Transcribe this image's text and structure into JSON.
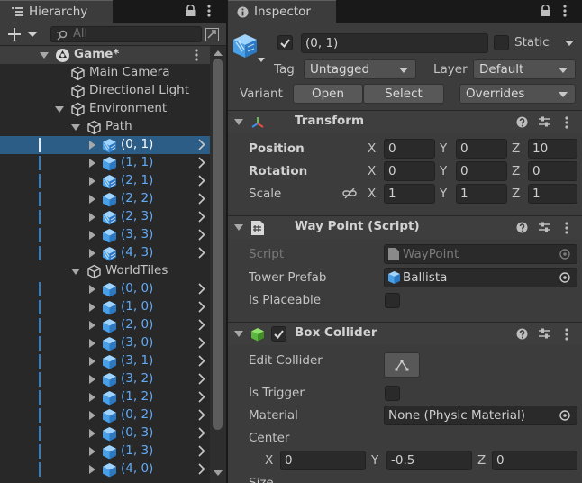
{
  "hierarchy": {
    "tab_label": "Hierarchy",
    "search_placeholder": "All",
    "rows": [
      {
        "label": "Game*",
        "depth": 0,
        "expanded": true,
        "kind": "scene"
      },
      {
        "label": "Main Camera",
        "depth": 1,
        "kind": "object"
      },
      {
        "label": "Directional Light",
        "depth": 1,
        "kind": "object"
      },
      {
        "label": "Environment",
        "depth": 1,
        "expanded": true,
        "kind": "object"
      },
      {
        "label": "Path",
        "depth": 2,
        "expanded": true,
        "kind": "object"
      },
      {
        "label": "(0, 1)",
        "depth": 3,
        "kind": "prefab-striped",
        "selected": true
      },
      {
        "label": "(1, 1)",
        "depth": 3,
        "kind": "prefab"
      },
      {
        "label": "(2, 1)",
        "depth": 3,
        "kind": "prefab-striped"
      },
      {
        "label": "(2, 2)",
        "depth": 3,
        "kind": "prefab"
      },
      {
        "label": "(2, 3)",
        "depth": 3,
        "kind": "prefab-striped"
      },
      {
        "label": "(3, 3)",
        "depth": 3,
        "kind": "prefab"
      },
      {
        "label": "(4, 3)",
        "depth": 3,
        "kind": "prefab-striped"
      },
      {
        "label": "WorldTiles",
        "depth": 2,
        "expanded": true,
        "kind": "object"
      },
      {
        "label": "(0, 0)",
        "depth": 3,
        "kind": "prefab"
      },
      {
        "label": "(1, 0)",
        "depth": 3,
        "kind": "prefab"
      },
      {
        "label": "(2, 0)",
        "depth": 3,
        "kind": "prefab"
      },
      {
        "label": "(3, 0)",
        "depth": 3,
        "kind": "prefab"
      },
      {
        "label": "(3, 1)",
        "depth": 3,
        "kind": "prefab"
      },
      {
        "label": "(3, 2)",
        "depth": 3,
        "kind": "prefab"
      },
      {
        "label": "(1, 2)",
        "depth": 3,
        "kind": "prefab"
      },
      {
        "label": "(0, 2)",
        "depth": 3,
        "kind": "prefab"
      },
      {
        "label": "(0, 3)",
        "depth": 3,
        "kind": "prefab"
      },
      {
        "label": "(1, 3)",
        "depth": 3,
        "kind": "prefab"
      },
      {
        "label": "(4, 0)",
        "depth": 3,
        "kind": "prefab"
      }
    ]
  },
  "inspector": {
    "tab_label": "Inspector",
    "object_name": "(0, 1)",
    "static_label": "Static",
    "tag_label": "Tag",
    "tag_value": "Untagged",
    "layer_label": "Layer",
    "layer_value": "Default",
    "variant_label": "Variant",
    "open_label": "Open",
    "select_label": "Select",
    "overrides_label": "Overrides",
    "transform": {
      "title": "Transform",
      "position_label": "Position",
      "rotation_label": "Rotation",
      "scale_label": "Scale",
      "axis_x": "X",
      "axis_y": "Y",
      "axis_z": "Z",
      "position": {
        "x": "0",
        "y": "0",
        "z": "10"
      },
      "rotation": {
        "x": "0",
        "y": "0",
        "z": "0"
      },
      "scale": {
        "x": "1",
        "y": "1",
        "z": "1"
      }
    },
    "waypoint": {
      "title": "Way Point (Script)",
      "script_label": "Script",
      "script_value": "WayPoint",
      "tower_label": "Tower Prefab",
      "tower_value": "Ballista",
      "placeable_label": "Is Placeable"
    },
    "boxcollider": {
      "title": "Box Collider",
      "edit_label": "Edit Collider",
      "trigger_label": "Is Trigger",
      "material_label": "Material",
      "material_value": "None (Physic Material)",
      "center_label": "Center",
      "center": {
        "x": "0",
        "y": "-0.5",
        "z": "0"
      },
      "size_label": "Size"
    }
  },
  "colors": {
    "selection": "#2c5d87",
    "prefab_blue": "#62aaf5",
    "panel": "#3c3c3c",
    "hierarchy_bg": "#282828"
  }
}
